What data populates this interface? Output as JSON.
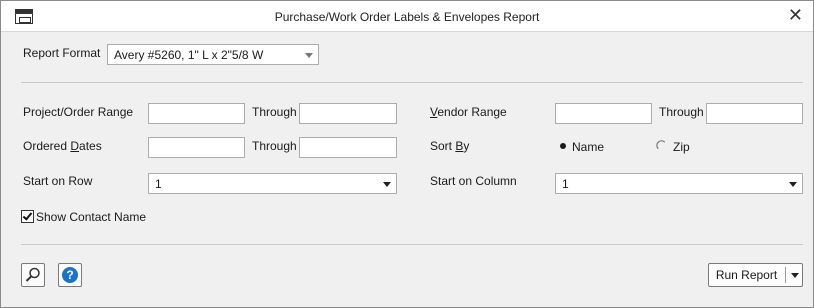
{
  "window": {
    "title": "Purchase/Work Order Labels & Envelopes Report",
    "close_glyph": "✕"
  },
  "report_format": {
    "label": "Report Format",
    "value": "Avery #5260, 1\" L x 2\"5/8 W"
  },
  "project_order_range": {
    "label": "Project/Order Range",
    "from_value": "",
    "through_label": "Through",
    "to_value": ""
  },
  "vendor_range": {
    "label_prefix": "V",
    "label_rest": "endor Range",
    "from_value": "",
    "through_label": "Through",
    "to_value": ""
  },
  "ordered_dates": {
    "label_prefix": "Ordered ",
    "label_underlined": "D",
    "label_rest": "ates",
    "from_value": "",
    "through_label": "Through",
    "to_value": ""
  },
  "sort_by": {
    "label_prefix": "Sort ",
    "label_underlined": "B",
    "label_rest": "y",
    "options": [
      {
        "label": "Name",
        "selected": true
      },
      {
        "label": "Zip",
        "selected": false
      }
    ]
  },
  "start_on_row": {
    "label": "Start on Row",
    "value": "1"
  },
  "start_on_column": {
    "label": "Start on Column",
    "value": "1"
  },
  "show_contact_name": {
    "label": "Show Contact Name",
    "checked": true
  },
  "footer": {
    "search_icon": "magnifier-icon",
    "help_icon": "help-icon",
    "help_glyph": "?",
    "run_report_label": "Run Report"
  },
  "colors": {
    "help_blue": "#1a73c9",
    "radio_dot": "#1a1a1a"
  }
}
